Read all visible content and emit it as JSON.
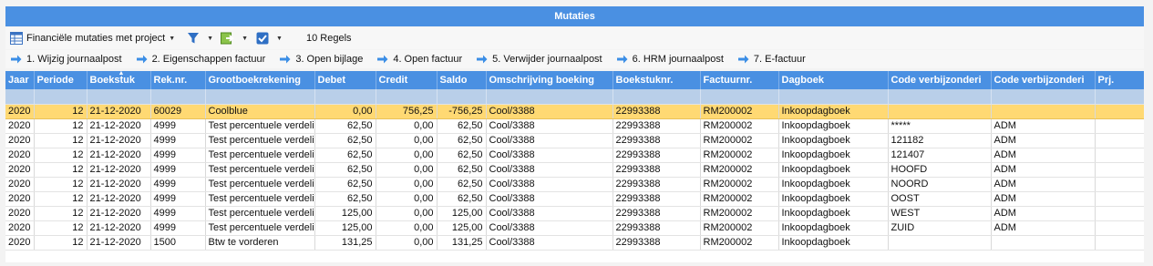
{
  "window": {
    "title": "Mutaties"
  },
  "toolbar": {
    "view_label": "Financiële mutaties met project",
    "count_label": "10 Regels",
    "icons": [
      "grid-icon",
      "filter-icon",
      "export-icon",
      "checkbox-icon"
    ]
  },
  "actions": [
    {
      "label": "1. Wijzig journaalpost"
    },
    {
      "label": "2. Eigenschappen factuur"
    },
    {
      "label": "3. Open bijlage"
    },
    {
      "label": "4. Open factuur"
    },
    {
      "label": "5. Verwijder journaalpost"
    },
    {
      "label": "6. HRM journaalpost"
    },
    {
      "label": "7. E-factuur"
    }
  ],
  "table": {
    "columns": [
      "Jaar",
      "Periode",
      "Boekstuk",
      "Rek.nr.",
      "Grootboekrekening",
      "Debet",
      "Credit",
      "Saldo",
      "Omschrijving boeking",
      "Boekstuknr.",
      "Factuurnr.",
      "Dagboek",
      "Code verbijzonderi",
      "Code verbijzonderi",
      "Prj."
    ],
    "sorted_column": "Boekstuk",
    "rows": [
      [
        "2020",
        "12",
        "21-12-2020",
        "60029",
        "Coolblue",
        "0,00",
        "756,25",
        "-756,25",
        "Cool/3388",
        "22993388",
        "RM200002",
        "Inkoopdagboek",
        "",
        "",
        ""
      ],
      [
        "2020",
        "12",
        "21-12-2020",
        "4999",
        "Test percentuele verdeli",
        "62,50",
        "0,00",
        "62,50",
        "Cool/3388",
        "22993388",
        "RM200002",
        "Inkoopdagboek",
        "*****",
        "ADM",
        ""
      ],
      [
        "2020",
        "12",
        "21-12-2020",
        "4999",
        "Test percentuele verdeli",
        "62,50",
        "0,00",
        "62,50",
        "Cool/3388",
        "22993388",
        "RM200002",
        "Inkoopdagboek",
        "121182",
        "ADM",
        ""
      ],
      [
        "2020",
        "12",
        "21-12-2020",
        "4999",
        "Test percentuele verdeli",
        "62,50",
        "0,00",
        "62,50",
        "Cool/3388",
        "22993388",
        "RM200002",
        "Inkoopdagboek",
        "121407",
        "ADM",
        ""
      ],
      [
        "2020",
        "12",
        "21-12-2020",
        "4999",
        "Test percentuele verdeli",
        "62,50",
        "0,00",
        "62,50",
        "Cool/3388",
        "22993388",
        "RM200002",
        "Inkoopdagboek",
        "HOOFD",
        "ADM",
        ""
      ],
      [
        "2020",
        "12",
        "21-12-2020",
        "4999",
        "Test percentuele verdeli",
        "62,50",
        "0,00",
        "62,50",
        "Cool/3388",
        "22993388",
        "RM200002",
        "Inkoopdagboek",
        "NOORD",
        "ADM",
        ""
      ],
      [
        "2020",
        "12",
        "21-12-2020",
        "4999",
        "Test percentuele verdeli",
        "62,50",
        "0,00",
        "62,50",
        "Cool/3388",
        "22993388",
        "RM200002",
        "Inkoopdagboek",
        "OOST",
        "ADM",
        ""
      ],
      [
        "2020",
        "12",
        "21-12-2020",
        "4999",
        "Test percentuele verdeli",
        "125,00",
        "0,00",
        "125,00",
        "Cool/3388",
        "22993388",
        "RM200002",
        "Inkoopdagboek",
        "WEST",
        "ADM",
        ""
      ],
      [
        "2020",
        "12",
        "21-12-2020",
        "4999",
        "Test percentuele verdeli",
        "125,00",
        "0,00",
        "125,00",
        "Cool/3388",
        "22993388",
        "RM200002",
        "Inkoopdagboek",
        "ZUID",
        "ADM",
        ""
      ],
      [
        "2020",
        "12",
        "21-12-2020",
        "1500",
        "Btw te vorderen",
        "131,25",
        "0,00",
        "131,25",
        "Cool/3388",
        "22993388",
        "RM200002",
        "Inkoopdagboek",
        "",
        "",
        ""
      ]
    ],
    "selected_row": 0
  },
  "colors": {
    "accent": "#4a90e2",
    "selected_row": "#ffd973",
    "filter_row": "#b9cfe9"
  }
}
